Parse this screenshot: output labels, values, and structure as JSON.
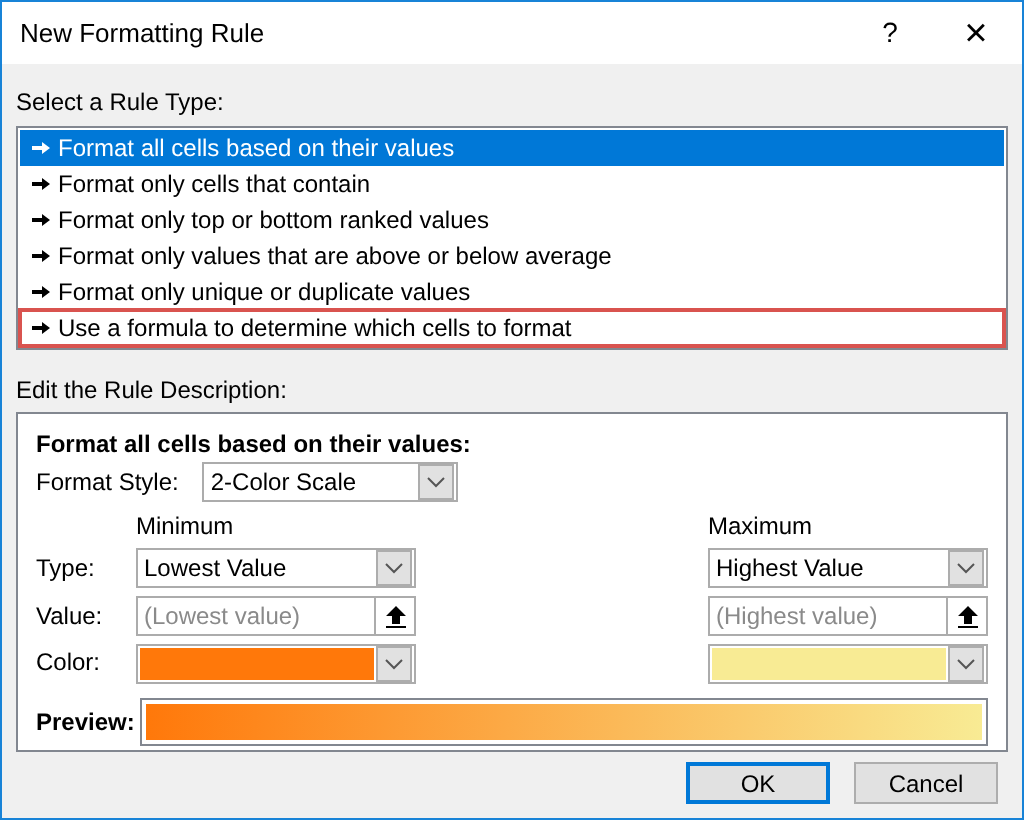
{
  "window": {
    "title": "New Formatting Rule",
    "help": "?",
    "close": "×"
  },
  "rule_type": {
    "label": "Select a Rule Type:",
    "items": [
      {
        "text": "Format all cells based on their values",
        "selected": true,
        "highlighted": false
      },
      {
        "text": "Format only cells that contain",
        "selected": false,
        "highlighted": false
      },
      {
        "text": "Format only top or bottom ranked values",
        "selected": false,
        "highlighted": false
      },
      {
        "text": "Format only values that are above or below average",
        "selected": false,
        "highlighted": false
      },
      {
        "text": "Format only unique or duplicate values",
        "selected": false,
        "highlighted": false
      },
      {
        "text": "Use a formula to determine which cells to format",
        "selected": false,
        "highlighted": true
      }
    ]
  },
  "description": {
    "label": "Edit the Rule Description:",
    "heading": "Format all cells based on their values:",
    "format_style": {
      "label": "Format Style:",
      "value": "2-Color Scale"
    },
    "row_labels": {
      "type_label": "Type:",
      "value_label": "Value:",
      "color_label": "Color:"
    },
    "columns": [
      {
        "heading": "Minimum",
        "type": "Lowest Value",
        "value_placeholder": "(Lowest value)",
        "color": "#ff780a"
      },
      {
        "heading": "Maximum",
        "type": "Highest Value",
        "value_placeholder": "(Highest value)",
        "color": "#f8eb94"
      }
    ],
    "preview_label": "Preview:"
  },
  "buttons": [
    "OK",
    "Cancel"
  ]
}
